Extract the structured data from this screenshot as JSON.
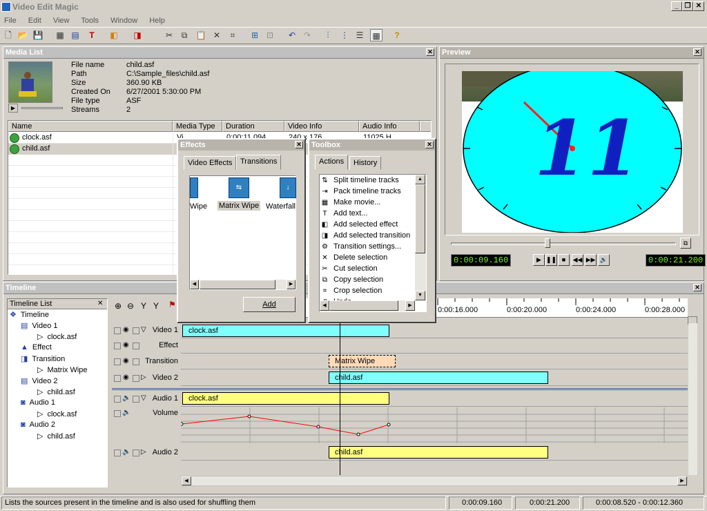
{
  "window": {
    "title": "Video Edit Magic"
  },
  "menu": [
    "File",
    "Edit",
    "View",
    "Tools",
    "Window",
    "Help"
  ],
  "media_list": {
    "title": "Media List",
    "info_labels": [
      "File name",
      "Path",
      "Size",
      "Created On",
      "File type",
      "Streams"
    ],
    "info_values": [
      "child.asf",
      "C:\\Sample_files\\child.asf",
      "360.90 KB",
      "6/27/2001 5:30:00 PM",
      "ASF",
      "2"
    ],
    "columns": [
      "Name",
      "Media Type",
      "Duration",
      "Video Info",
      "Audio Info"
    ],
    "rows": [
      {
        "name": "clock.asf",
        "type": "Vi...",
        "duration": "0:00:11.094",
        "video": "240 x 176...",
        "audio": "11025 H..."
      },
      {
        "name": "child.asf",
        "type": "",
        "duration": "",
        "video": "",
        "audio": ""
      }
    ]
  },
  "preview": {
    "title": "Preview",
    "current_time": "0:00:09.160",
    "end_time": "0:00:21.200",
    "position_fraction": 0.43,
    "clock_number": "11"
  },
  "effects": {
    "title": "Effects",
    "tabs": [
      "Video Effects",
      "Transitions"
    ],
    "items": [
      "Wipe",
      "Matrix Wipe",
      "Waterfall"
    ],
    "add_label": "Add"
  },
  "toolbox": {
    "title": "Toolbox",
    "tabs": [
      "Actions",
      "History"
    ],
    "actions": [
      "Split timeline tracks",
      "Pack timeline tracks",
      "Make movie...",
      "Add text...",
      "Add selected effect",
      "Add selected transition",
      "Transition settings...",
      "Delete selection",
      "Cut selection",
      "Copy selection",
      "Crop selection",
      "Undo"
    ]
  },
  "timeline": {
    "title": "Timeline",
    "list_title": "Timeline List",
    "tree": [
      {
        "label": "Timeline",
        "level": 0
      },
      {
        "label": "Video 1",
        "level": 1
      },
      {
        "label": "clock.asf",
        "level": 2
      },
      {
        "label": "Effect",
        "level": 1
      },
      {
        "label": "Transition",
        "level": 1
      },
      {
        "label": "Matrix Wipe",
        "level": 2
      },
      {
        "label": "Video 2",
        "level": 1
      },
      {
        "label": "child.asf",
        "level": 2
      },
      {
        "label": "Audio 1",
        "level": 1
      },
      {
        "label": "clock.asf",
        "level": 2
      },
      {
        "label": "Audio 2",
        "level": 1
      },
      {
        "label": "child.asf",
        "level": 2
      }
    ],
    "ruler": [
      "0:00:16.000",
      "0:00:20.000",
      "0:00:24.000",
      "0:00:28.000"
    ],
    "tracks": [
      "Video 1",
      "Effect",
      "Transition",
      "Video 2",
      "Audio 1",
      "Volume",
      "Audio 2"
    ],
    "clips": {
      "video1": "clock.asf",
      "transition": "Matrix Wipe",
      "video2": "child.asf",
      "audio1": "clock.asf",
      "audio2": "child.asf"
    }
  },
  "status": {
    "message": "Lists the sources present in the timeline and is also used for shuffling them",
    "current": "0:00:09.160",
    "total": "0:00:21.200",
    "selection": "0:00:08.520 - 0:00:12.360"
  },
  "colors": {
    "video_clip": "#80ffff",
    "audio_clip": "#ffff80",
    "transition_clip": "#ffdab9",
    "lcd_text": "#7cfc00",
    "clock_face": "#00ffff",
    "volume_line": "#ff0000"
  }
}
